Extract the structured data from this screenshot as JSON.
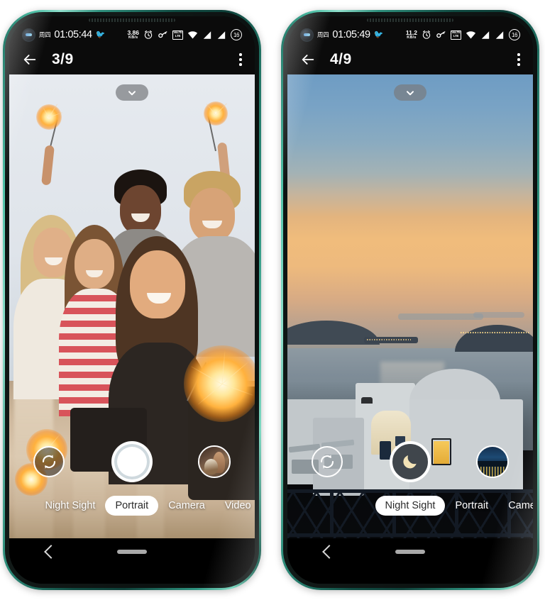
{
  "phones": [
    {
      "id": "phone-left",
      "statusbar": {
        "day": "周四",
        "time": "01:05:44",
        "bird_icon": "bird-icon",
        "net_speed_value": "3.86",
        "net_speed_unit": "KB/s",
        "alarm_icon": "alarm-clock-icon",
        "vpn_icon": "vpn-key-icon",
        "volte_top": "VoLTE",
        "volte_bottom": "LTE",
        "wifi_icon": "wifi-icon",
        "signal_icon_1": "signal-bars-icon",
        "signal_icon_2": "signal-bars-icon",
        "battery_level": "16"
      },
      "appbar": {
        "back_icon": "back-arrow-icon",
        "page_count": "3/9",
        "menu_icon": "overflow-menu-icon"
      },
      "viewfinder": {
        "collapse_icon": "chevron-down-icon",
        "scene": "group-selfie-sparklers"
      },
      "controls": {
        "flip_icon": "flip-camera-icon",
        "shutter_icon": "shutter-button",
        "shutter_mode": "photo",
        "thumbnail": "gallery-thumbnail-woman-dog"
      },
      "modes": [
        {
          "label": "Night Sight",
          "active": false
        },
        {
          "label": "Portrait",
          "active": true
        },
        {
          "label": "Camera",
          "active": false
        },
        {
          "label": "Video",
          "active": false
        }
      ],
      "navbar": {
        "back_icon": "nav-back-icon",
        "home_icon": "nav-home-indicator"
      }
    },
    {
      "id": "phone-right",
      "statusbar": {
        "day": "周四",
        "time": "01:05:49",
        "bird_icon": "bird-icon",
        "net_speed_value": "11.2",
        "net_speed_unit": "KB/s",
        "alarm_icon": "alarm-clock-icon",
        "vpn_icon": "vpn-key-icon",
        "volte_top": "VoLTE",
        "volte_bottom": "LTE",
        "wifi_icon": "wifi-icon",
        "signal_icon_1": "signal-bars-icon",
        "signal_icon_2": "signal-bars-icon",
        "battery_level": "16"
      },
      "appbar": {
        "back_icon": "back-arrow-icon",
        "page_count": "4/9",
        "menu_icon": "overflow-menu-icon"
      },
      "viewfinder": {
        "collapse_icon": "chevron-down-icon",
        "scene": "santorini-sunset"
      },
      "controls": {
        "flip_icon": "flip-camera-icon",
        "shutter_icon": "moon-icon",
        "shutter_mode": "night",
        "thumbnail": "gallery-thumbnail-night-skyline"
      },
      "modes": [
        {
          "label": "Night Sight",
          "active": true
        },
        {
          "label": "Portrait",
          "active": false
        },
        {
          "label": "Camera",
          "active": false
        }
      ],
      "navbar": {
        "back_icon": "nav-back-icon",
        "home_icon": "nav-home-indicator"
      }
    }
  ],
  "colors": {
    "frame_accent": "#2f9581",
    "status_bg": "#0b0b0b",
    "active_pill": "#ffffff",
    "shutter_night_bg": "#40464c",
    "moon": "#f3e3b6"
  }
}
